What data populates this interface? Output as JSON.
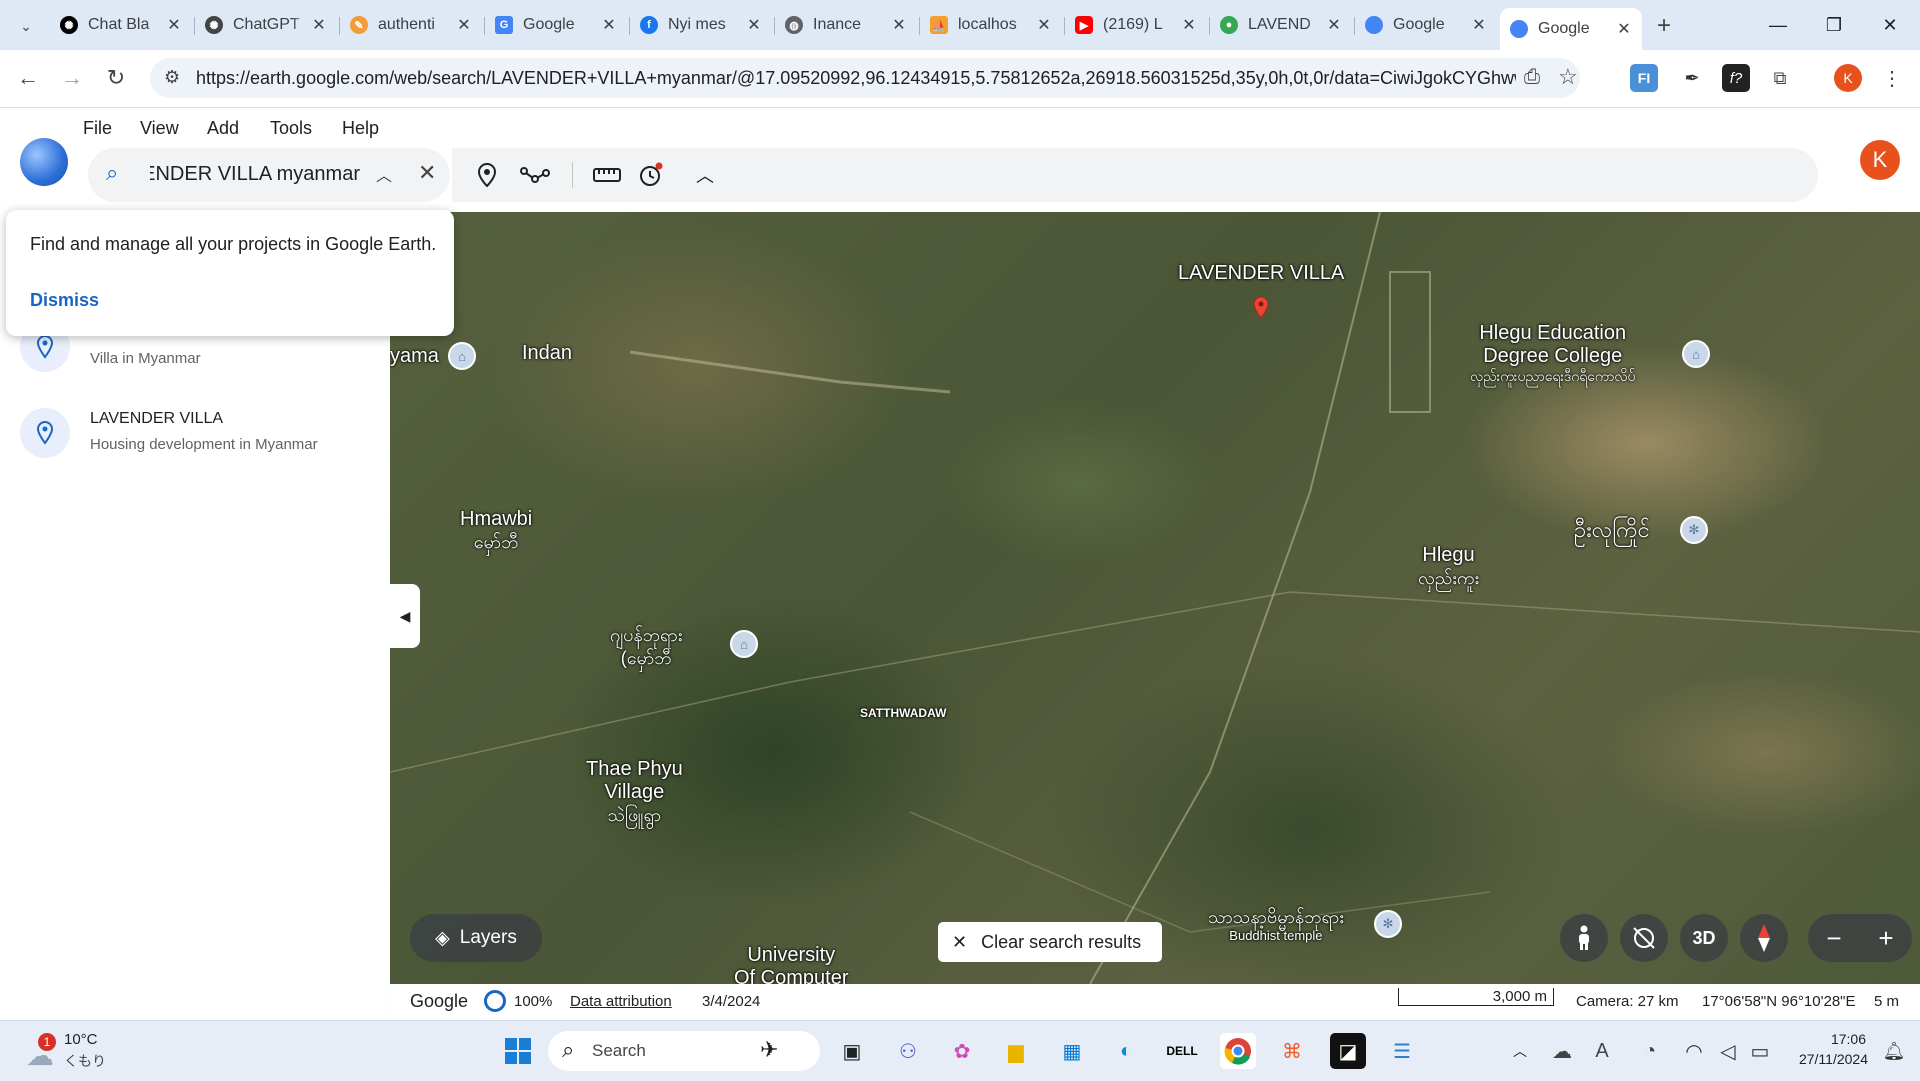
{
  "browser": {
    "tabs": [
      {
        "title": "Chat Bla",
        "icon": "openai-icon",
        "color": "#000000"
      },
      {
        "title": "ChatGPT",
        "icon": "openai-icon",
        "color": "#444444"
      },
      {
        "title": "authenti",
        "icon": "quill-icon",
        "color": "#f29b38"
      },
      {
        "title": "Google",
        "icon": "google-translate-icon",
        "color": "#4285f4"
      },
      {
        "title": "Nyi mes",
        "icon": "facebook-icon",
        "color": "#1877f2"
      },
      {
        "title": "Inance",
        "icon": "globe-icon",
        "color": "#5f6368"
      },
      {
        "title": "localhos",
        "icon": "phpmyadmin-icon",
        "color": "#f0a030"
      },
      {
        "title": "(2169) L",
        "icon": "youtube-icon",
        "color": "#ff0000"
      },
      {
        "title": "LAVEND",
        "icon": "maps-pin-icon",
        "color": "#34a853"
      },
      {
        "title": "Google",
        "icon": "google-earth-icon",
        "color": "#4285f4"
      },
      {
        "title": "Google",
        "icon": "google-earth-icon",
        "color": "#4285f4",
        "active": true
      }
    ],
    "url": "https://earth.google.com/web/search/LAVENDER+VILLA+myanmar/@17.09520992,96.12434915,5.75812652a,26918.56031525d,35y,0h,0t,0r/data=CiwiJgokCYGhwwJOHz...",
    "profile_initial": "K"
  },
  "earth": {
    "menu": [
      "File",
      "View",
      "Add",
      "Tools",
      "Help"
    ],
    "search_value": "LAVENDER VILLA myanmar",
    "avatar_initial": "K"
  },
  "popup": {
    "message": "Find and manage all your projects in Google Earth.",
    "dismiss_label": "Dismiss"
  },
  "results": [
    {
      "title": "",
      "subtitle": "Villa in Myanmar"
    },
    {
      "title": "LAVENDER VILLA",
      "subtitle": "Housing development in Myanmar"
    }
  ],
  "map": {
    "labels": {
      "lavender": "LAVENDER VILLA",
      "yama": "yama",
      "indan": "Indan",
      "hmawbi": "Hmawbi",
      "hmawbi_mm": "မှော်ဘီ",
      "hlegu_college": "Hlegu Education",
      "hlegu_college2": "Degree College",
      "hlegu_college_mm": "လှည်းကူးပညာရေးဒီဂရီကောလိပ်",
      "pagoda_mm": "ဦးလုကြိုင်",
      "hlegu": "Hlegu",
      "hlegu_mm": "လှည်းကူး",
      "market_mm": "ဂျပန်ဘုရား",
      "market_mm2": "(မှော်ဘီ",
      "satthwadaw": "SATTHWADAW",
      "thae_phyu": "Thae Phyu",
      "thae_phyu2": "Village",
      "thae_phyu_mm": "သဲဖြူရွာ",
      "temple_mm": "သာသနာ့ဗိမ္မာန်ဘုရား",
      "temple": "Buddhist temple",
      "university": "University",
      "university2": "Of Computer"
    },
    "layers_label": "Layers",
    "clear_label": "Clear search results",
    "view_3d_label": "3D"
  },
  "status": {
    "google": "Google",
    "percent": "100%",
    "attribution": "Data attribution",
    "date": "3/4/2024",
    "scale": "3,000 m",
    "camera": "Camera: 27 km",
    "coords": "17°06'58\"N 96°10'28\"E",
    "elev": "5 m"
  },
  "taskbar": {
    "weather_badge": "1",
    "temp": "10°C",
    "weather_desc": "くもり",
    "search_placeholder": "Search",
    "time": "17:06",
    "date": "27/11/2024"
  }
}
